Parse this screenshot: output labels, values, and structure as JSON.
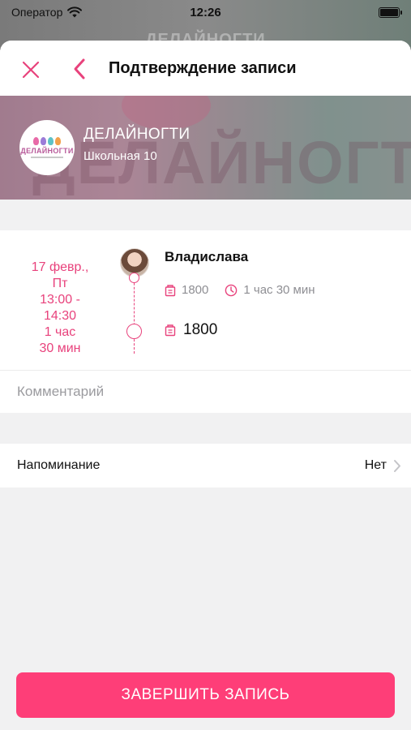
{
  "status_bar": {
    "carrier": "Оператор",
    "time": "12:26"
  },
  "backdrop": {
    "title": "ДЕЛАЙНОГТИ"
  },
  "nav": {
    "title": "Подтверждение записи",
    "close_icon": "close-icon",
    "back_icon": "chevron-left-icon"
  },
  "salon": {
    "name": "ДЕЛАЙНОГТИ",
    "address": "Школьная 10",
    "logo_text": "ДЕЛАЙНОГТИ",
    "banner_text": "ДЕЛАЙНОГТИ"
  },
  "appointment": {
    "date_lines": [
      "17 февр.,",
      "Пт",
      "13:00 -",
      "14:30",
      "1 час",
      "30 мин"
    ],
    "master_name": "Владислава",
    "service_price": "1800",
    "service_duration": "1 час 30 мин",
    "total_price": "1800"
  },
  "comment": {
    "placeholder": "Комментарий",
    "value": ""
  },
  "reminder": {
    "label": "Напоминание",
    "value": "Нет"
  },
  "finish_button": {
    "label": "ЗАВЕРШИТЬ ЗАПИСЬ"
  },
  "colors": {
    "accent": "#e8427c",
    "button": "#fe3e78",
    "background": "#f1f1f2"
  }
}
